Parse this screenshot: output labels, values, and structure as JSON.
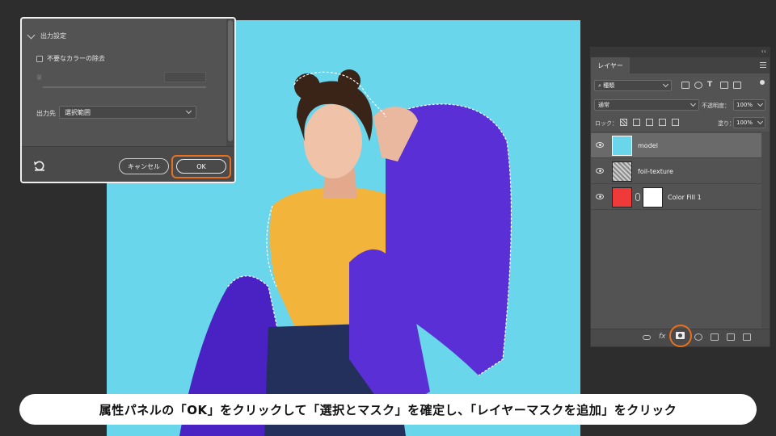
{
  "properties": {
    "section_title": "出力設定",
    "decontaminate_label": "不要なカラーの除去",
    "amount_label": "量",
    "output_label": "出力先",
    "output_value": "選択範囲",
    "cancel_label": "キャンセル",
    "ok_label": "OK"
  },
  "layers_panel": {
    "tab_label": "レイヤー",
    "collapse_glyph": "‹‹",
    "kind_filter": "種類",
    "blend_mode": "通常",
    "opacity_label": "不透明度：",
    "opacity_value": "100%",
    "lock_label": "ロック：",
    "fill_label": "塗り：",
    "fill_value": "100%",
    "layers": [
      {
        "name": "model",
        "selected": true
      },
      {
        "name": "foil-texture",
        "selected": false
      },
      {
        "name": "Color Fill 1",
        "selected": false,
        "fill_color": "#f03a3a"
      }
    ],
    "fx_label": "fx"
  },
  "caption": "属性パネルの「OK」をクリックして「選択とマスク」を確定し、「レイヤーマスクを追加」をクリック",
  "colors": {
    "canvas_bg": "#6ad6ec",
    "jacket": "#5a2fd6",
    "sweater": "#f2b43a",
    "highlight": "#e8701e"
  }
}
